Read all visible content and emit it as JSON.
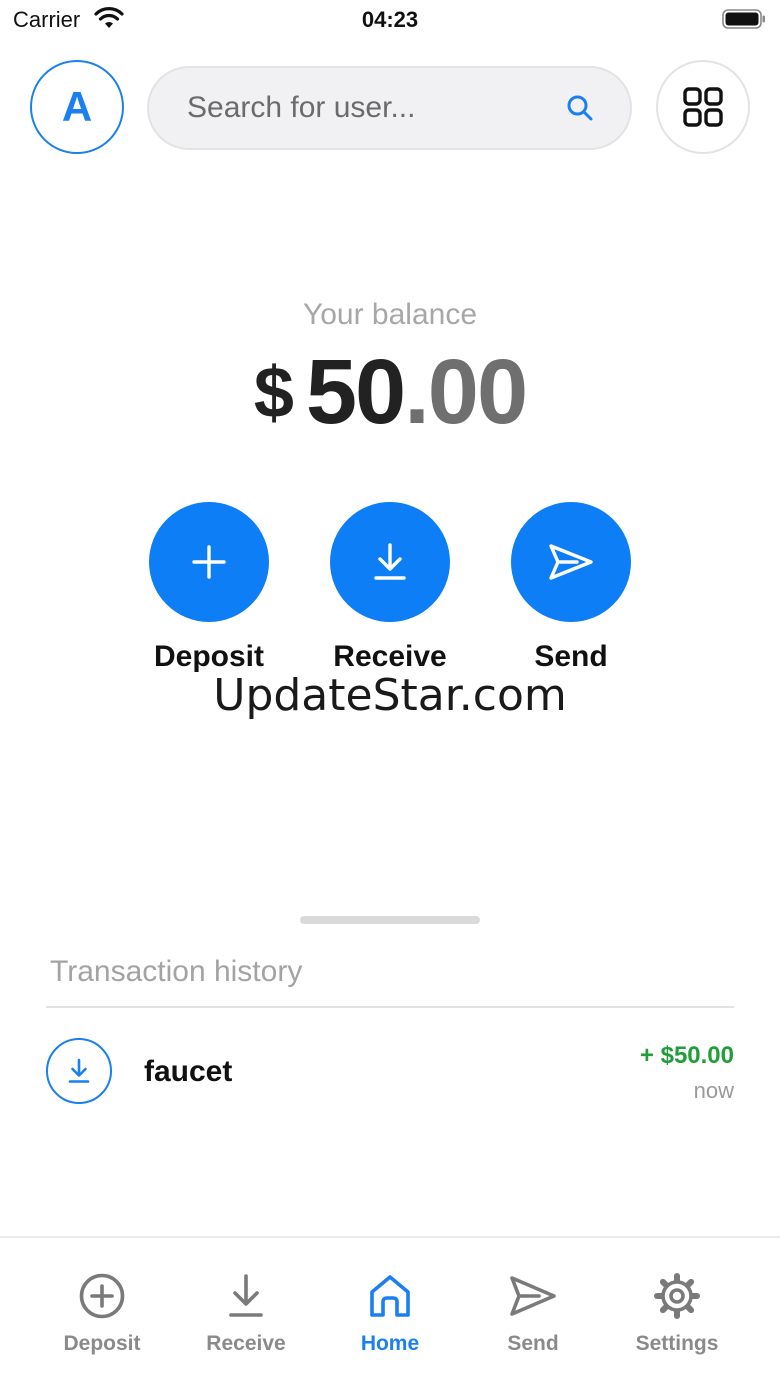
{
  "status_bar": {
    "carrier": "Carrier",
    "time": "04:23"
  },
  "header": {
    "avatar_initial": "A",
    "search_placeholder": "Search for user..."
  },
  "balance": {
    "label": "Your balance",
    "currency": "$",
    "whole": "50",
    "decimal": ".00"
  },
  "actions": [
    {
      "label": "Deposit",
      "icon": "plus-icon"
    },
    {
      "label": "Receive",
      "icon": "download-icon"
    },
    {
      "label": "Send",
      "icon": "send-icon"
    }
  ],
  "watermark": "UpdateStar.com",
  "transactions": {
    "title": "Transaction history",
    "items": [
      {
        "name": "faucet",
        "amount": "+ $50.00",
        "time": "now",
        "icon": "download-icon"
      }
    ]
  },
  "tabbar": {
    "items": [
      {
        "label": "Deposit",
        "icon": "plus-circle-icon"
      },
      {
        "label": "Receive",
        "icon": "download-icon"
      },
      {
        "label": "Home",
        "icon": "home-icon",
        "active": true
      },
      {
        "label": "Send",
        "icon": "send-icon"
      },
      {
        "label": "Settings",
        "icon": "gear-icon"
      }
    ]
  },
  "colors": {
    "accent": "#0d7ef5",
    "positive": "#1f9e3a"
  }
}
